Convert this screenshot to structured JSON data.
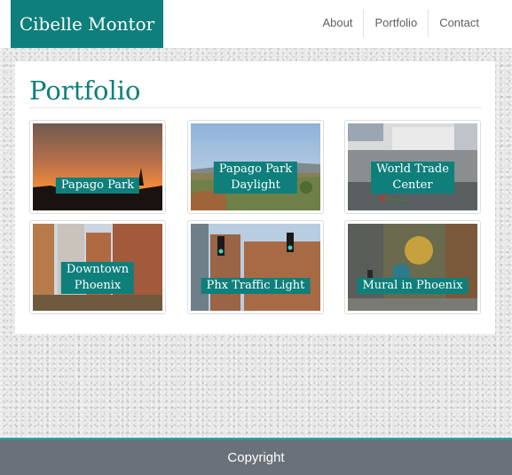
{
  "site": {
    "logo": "Cibelle Montor"
  },
  "nav": {
    "items": [
      "About",
      "Portfolio",
      "Contact"
    ]
  },
  "page": {
    "title": "Portfolio"
  },
  "gallery": [
    {
      "caption": "Papago Park",
      "image": "sunset-desert"
    },
    {
      "caption": "Papago Park Daylight",
      "caption_lines": [
        "Papago Park",
        "Daylight"
      ],
      "image": "desert-daylight"
    },
    {
      "caption": "World Trade Center",
      "caption_lines": [
        "World Trade",
        "Center"
      ],
      "image": "memorial-pool"
    },
    {
      "caption": "Downtown Phoenix",
      "caption_lines": [
        "Downtown",
        "Phoenix"
      ],
      "image": "city-buildings"
    },
    {
      "caption": "Phx Traffic Light",
      "image": "traffic-light"
    },
    {
      "caption": "Mural in Phoenix",
      "image": "street-mural"
    }
  ],
  "footer": {
    "text": "Copyright"
  },
  "colors": {
    "accent": "#0e7f7b",
    "footer": "#6a717a",
    "footer_border": "#20a8ac"
  }
}
